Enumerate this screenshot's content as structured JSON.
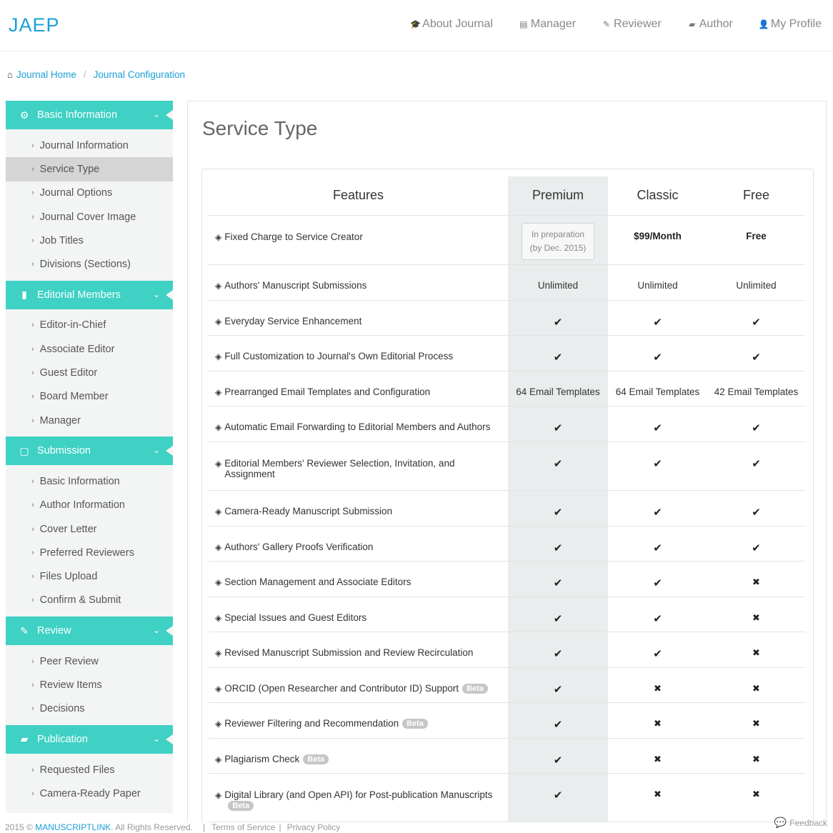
{
  "brand": "JAEP",
  "nav": [
    {
      "label": "About Journal",
      "icon": "graduation-cap-icon",
      "glyph": "🎓"
    },
    {
      "label": "Manager",
      "icon": "id-card-icon",
      "glyph": "▤"
    },
    {
      "label": "Reviewer",
      "icon": "edit-icon",
      "glyph": "✎"
    },
    {
      "label": "Author",
      "icon": "book-icon",
      "glyph": "▰"
    },
    {
      "label": "My Profile",
      "icon": "user-icon",
      "glyph": "👤"
    }
  ],
  "breadcrumb": {
    "home": "Journal Home",
    "current": "Journal Configuration"
  },
  "sidebar": [
    {
      "title": "Basic Information",
      "icon": "gear-icon",
      "glyph": "⚙",
      "items": [
        "Journal Information",
        "Service Type",
        "Journal Options",
        "Journal Cover Image",
        "Job Titles",
        "Divisions (Sections)"
      ]
    },
    {
      "title": "Editorial Members",
      "icon": "briefcase-icon",
      "glyph": "▮",
      "items": [
        "Editor-in-Chief",
        "Associate Editor",
        "Guest Editor",
        "Board Member",
        "Manager"
      ]
    },
    {
      "title": "Submission",
      "icon": "file-icon",
      "glyph": "▢",
      "items": [
        "Basic Information",
        "Author Information",
        "Cover Letter",
        "Preferred Reviewers",
        "Files Upload",
        "Confirm & Submit"
      ]
    },
    {
      "title": "Review",
      "icon": "edit-icon",
      "glyph": "✎",
      "items": [
        "Peer Review",
        "Review Items",
        "Decisions"
      ]
    },
    {
      "title": "Publication",
      "icon": "book-icon",
      "glyph": "▰",
      "items": [
        "Requested Files",
        "Camera-Ready Paper"
      ]
    }
  ],
  "active_item": "Service Type",
  "page_title": "Service Type",
  "table": {
    "headers": [
      "Features",
      "Premium",
      "Classic",
      "Free"
    ],
    "rows": [
      {
        "feature": "Fixed Charge to Service Creator",
        "beta": "",
        "premium": {
          "type": "prep",
          "text": "In preparation (by Dec. 2015)"
        },
        "classic": {
          "type": "price",
          "text": "$99/Month"
        },
        "free": {
          "type": "price",
          "text": "Free"
        },
        "h": 69
      },
      {
        "feature": "Authors' Manuscript Submissions",
        "beta": "",
        "premium": {
          "type": "text",
          "text": "Unlimited"
        },
        "classic": {
          "type": "text",
          "text": "Unlimited"
        },
        "free": {
          "type": "text",
          "text": "Unlimited"
        },
        "h": 50
      },
      {
        "feature": "Everyday Service Enhancement",
        "beta": "",
        "premium": {
          "type": "check"
        },
        "classic": {
          "type": "check"
        },
        "free": {
          "type": "check"
        },
        "h": 49
      },
      {
        "feature": "Full Customization to Journal's Own Editorial Process",
        "beta": "",
        "premium": {
          "type": "check"
        },
        "classic": {
          "type": "check"
        },
        "free": {
          "type": "check"
        },
        "h": 50
      },
      {
        "feature": "Prearranged Email Templates and Configuration",
        "beta": "",
        "premium": {
          "type": "text",
          "text": "64 Email Templates"
        },
        "classic": {
          "type": "text",
          "text": "64 Email Templates"
        },
        "free": {
          "type": "text",
          "text": "42 Email Templates"
        },
        "h": 49
      },
      {
        "feature": "Automatic Email Forwarding to Editorial Members and Authors",
        "beta": "",
        "premium": {
          "type": "check"
        },
        "classic": {
          "type": "check"
        },
        "free": {
          "type": "check"
        },
        "h": 50
      },
      {
        "feature": "Editorial Members' Reviewer Selection, Invitation, and Assignment",
        "beta": "",
        "premium": {
          "type": "check"
        },
        "classic": {
          "type": "check"
        },
        "free": {
          "type": "check"
        },
        "h": 68
      },
      {
        "feature": "Camera-Ready Manuscript Submission",
        "beta": "",
        "premium": {
          "type": "check"
        },
        "classic": {
          "type": "check"
        },
        "free": {
          "type": "check"
        },
        "h": 50
      },
      {
        "feature": "Authors' Gallery Proofs Verification",
        "beta": "",
        "premium": {
          "type": "check"
        },
        "classic": {
          "type": "check"
        },
        "free": {
          "type": "check"
        },
        "h": 49
      },
      {
        "feature": "Section Management and Associate Editors",
        "beta": "",
        "premium": {
          "type": "check"
        },
        "classic": {
          "type": "check"
        },
        "free": {
          "type": "cross"
        },
        "h": 50
      },
      {
        "feature": "Special Issues and Guest Editors",
        "beta": "",
        "premium": {
          "type": "check"
        },
        "classic": {
          "type": "check"
        },
        "free": {
          "type": "cross"
        },
        "h": 49
      },
      {
        "feature": "Revised Manuscript Submission and Review Recirculation",
        "beta": "",
        "premium": {
          "type": "check"
        },
        "classic": {
          "type": "check"
        },
        "free": {
          "type": "cross"
        },
        "h": 50
      },
      {
        "feature": "ORCID (Open Researcher and Contributor ID) Support",
        "beta": "Beta",
        "premium": {
          "type": "check"
        },
        "classic": {
          "type": "cross"
        },
        "free": {
          "type": "cross"
        },
        "h": 49
      },
      {
        "feature": "Reviewer Filtering and Recommendation",
        "beta": "Beta",
        "premium": {
          "type": "check"
        },
        "classic": {
          "type": "cross"
        },
        "free": {
          "type": "cross"
        },
        "h": 50
      },
      {
        "feature": "Plagiarism Check",
        "beta": "Beta",
        "premium": {
          "type": "check"
        },
        "classic": {
          "type": "cross"
        },
        "free": {
          "type": "cross"
        },
        "h": 49
      },
      {
        "feature": "Digital Library (and Open API) for Post-publication Manuscripts",
        "beta": "Beta",
        "premium": {
          "type": "check"
        },
        "classic": {
          "type": "cross"
        },
        "free": {
          "type": "cross"
        },
        "h": 68
      }
    ]
  },
  "footer": {
    "copyright": "2015 ©",
    "company": "MANUSCRIPTLINK",
    "rights": ". All Rights Reserved.",
    "links": [
      "Terms of Service",
      "Privacy Policy"
    ]
  },
  "feedback": "Feedback",
  "colors": {
    "accent": "#3ed1c4",
    "link": "#1b9fd6",
    "premium_column": "#eaeded"
  }
}
